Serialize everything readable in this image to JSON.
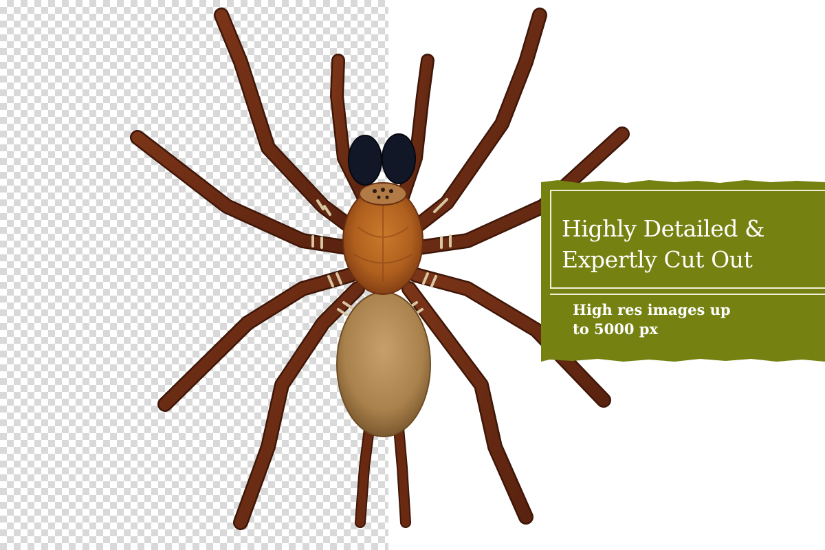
{
  "promo": {
    "headline_line1": "Highly Detailed &",
    "headline_line2": "Expertly Cut Out",
    "sub_line1": "High res images up",
    "sub_line2": "to 5000 px"
  },
  "colors": {
    "card_green": "#758211",
    "card_text": "#ffffff",
    "checker_grey": "#d9d9d9",
    "spider_leg": "#6e2d14",
    "spider_thorax": "#b0601e",
    "spider_abdomen": "#b08a55",
    "spider_eyes": "#111726"
  },
  "icons": [
    "transparency-checkerboard",
    "spider-illustration"
  ]
}
